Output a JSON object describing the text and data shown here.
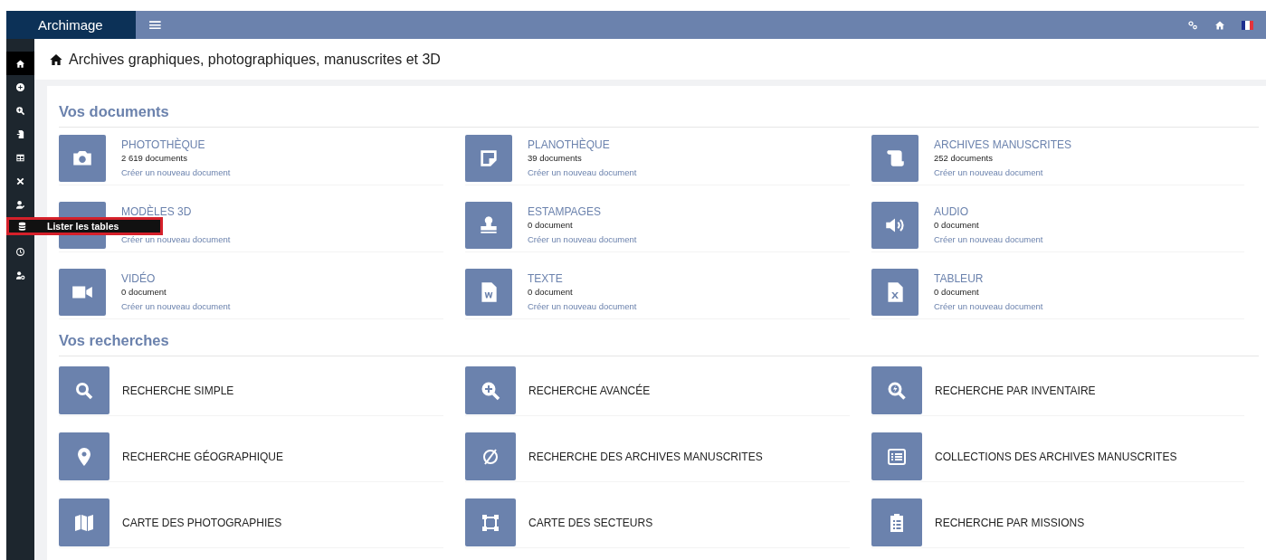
{
  "header": {
    "app_name": "Archimage",
    "menu_glyph": "≡"
  },
  "sidebar": {
    "items": [
      {
        "selected": true
      },
      {
        "selected": false
      },
      {
        "selected": false
      },
      {
        "selected": false
      },
      {
        "selected": false
      },
      {
        "selected": false
      },
      {
        "selected": false
      },
      {
        "selected": false,
        "tooltip": "Lister les tables"
      },
      {
        "selected": false
      },
      {
        "selected": false
      }
    ]
  },
  "page_title": "Archives graphiques, photographiques, manuscrites et 3D",
  "documents": {
    "heading": "Vos documents",
    "items": [
      {
        "title": "PHOTOTHÈQUE",
        "count": "2 619 documents",
        "link": "Créer un nouveau document"
      },
      {
        "title": "PLANOTHÈQUE",
        "count": "39 documents",
        "link": "Créer un nouveau document"
      },
      {
        "title": "ARCHIVES MANUSCRITES",
        "count": "252 documents",
        "link": "Créer un nouveau document"
      },
      {
        "title": "MODÈLES 3D",
        "link": "Créer un nouveau document"
      },
      {
        "title": "ESTAMPAGES",
        "count": "0 document",
        "link": "Créer un nouveau document"
      },
      {
        "title": "AUDIO",
        "count": "0 document",
        "link": "Créer un nouveau document"
      },
      {
        "title": "VIDÉO",
        "count": "0 document",
        "link": "Créer un nouveau document"
      },
      {
        "title": "TEXTE",
        "count": "0 document",
        "link": "Créer un nouveau document"
      },
      {
        "title": "TABLEUR",
        "count": "0 document",
        "link": "Créer un nouveau document"
      }
    ]
  },
  "searches": {
    "heading": "Vos recherches",
    "items": [
      {
        "label": "RECHERCHE SIMPLE"
      },
      {
        "label": "RECHERCHE AVANCÉE"
      },
      {
        "label": "RECHERCHE PAR INVENTAIRE"
      },
      {
        "label": "RECHERCHE GÉOGRAPHIQUE"
      },
      {
        "label": "RECHERCHE DES ARCHIVES MANUSCRITES"
      },
      {
        "label": "COLLECTIONS DES ARCHIVES MANUSCRITES"
      },
      {
        "label": "CARTE DES PHOTOGRAPHIES"
      },
      {
        "label": "CARTE DES SECTEURS"
      },
      {
        "label": "RECHERCHE PAR MISSIONS"
      }
    ]
  }
}
